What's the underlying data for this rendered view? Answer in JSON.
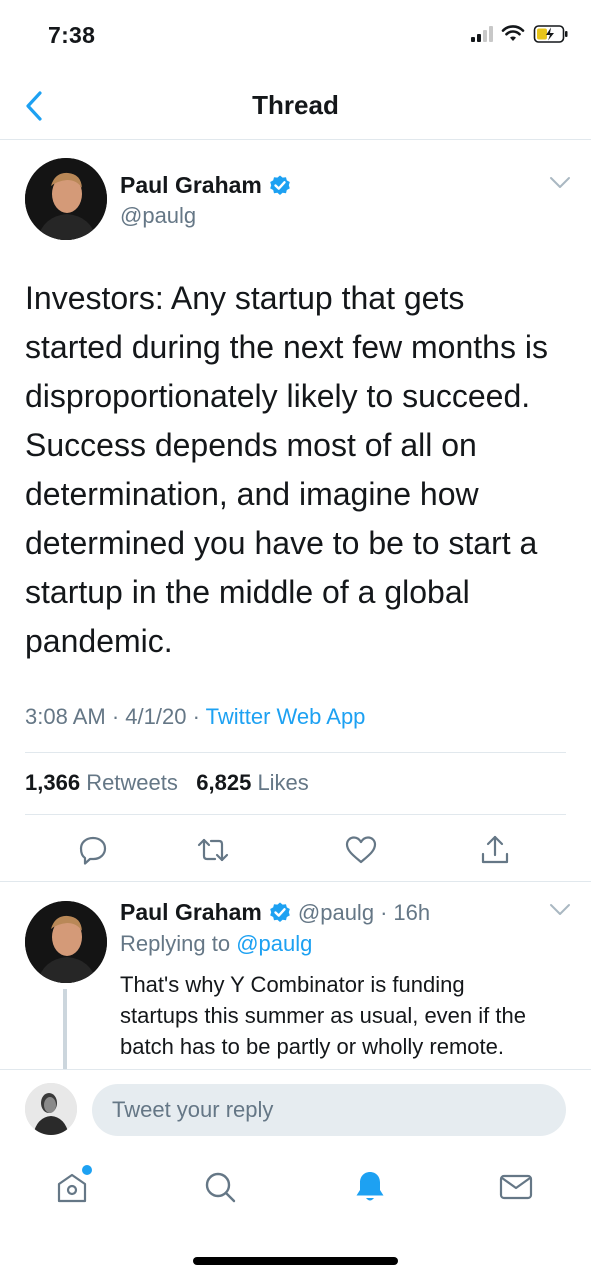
{
  "status_bar": {
    "time": "7:38"
  },
  "nav": {
    "title": "Thread"
  },
  "main_tweet": {
    "author_name": "Paul Graham",
    "author_handle": "@paulg",
    "verified": true,
    "text": "Investors: Any startup that gets started during the next few months is disproportionately likely to succeed. Success depends most of all on determination, and imagine how determined you have to be to start a startup in the middle of a global pandemic.",
    "time": "3:08 AM",
    "date": "4/1/20",
    "source": "Twitter Web App",
    "retweets_count": "1,366",
    "retweets_label": "Retweets",
    "likes_count": "6,825",
    "likes_label": "Likes",
    "actions": [
      "reply-icon",
      "retweet-icon",
      "like-icon",
      "share-icon"
    ]
  },
  "reply_tweet": {
    "author_name": "Paul Graham",
    "author_handle": "@paulg",
    "age": "16h",
    "replying_label": "Replying to",
    "replying_to": "@paulg",
    "text": "That's why Y Combinator is funding startups this summer as usual, even if the batch has to be partly or wholly remote. YC has run this for years in"
  },
  "composer": {
    "placeholder": "Tweet your reply"
  },
  "tab_bar": {
    "tabs": [
      "home-icon",
      "search-icon",
      "notifications-icon",
      "messages-icon"
    ],
    "active": "notifications-icon"
  },
  "colors": {
    "accent": "#1da1f2",
    "secondary_text": "#657786",
    "divider": "#e1e8ed"
  }
}
